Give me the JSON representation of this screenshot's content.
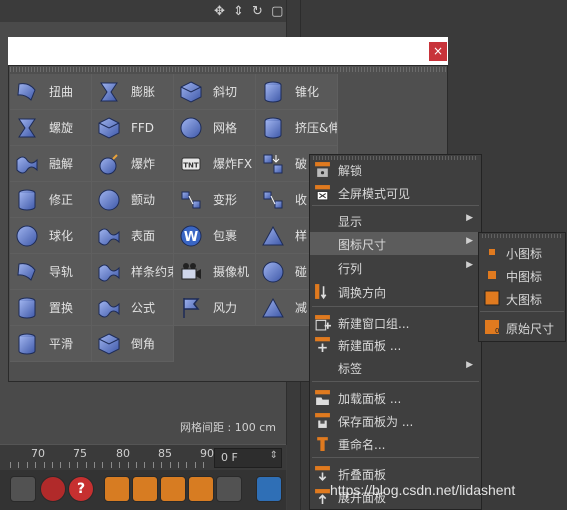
{
  "palette": {
    "items": [
      {
        "label": "扭曲",
        "icon": "bend-icon"
      },
      {
        "label": "膨胀",
        "icon": "bulge-icon"
      },
      {
        "label": "斜切",
        "icon": "shear-icon"
      },
      {
        "label": "锥化",
        "icon": "taper-icon"
      },
      {
        "label": "螺旋",
        "icon": "twist-icon"
      },
      {
        "label": "FFD",
        "icon": "ffd-icon"
      },
      {
        "label": "网格",
        "icon": "mesh-icon"
      },
      {
        "label": "挤压&伸展",
        "icon": "squash-stretch-icon"
      },
      {
        "label": "融解",
        "icon": "melt-icon"
      },
      {
        "label": "爆炸",
        "icon": "explosion-icon"
      },
      {
        "label": "爆炸FX",
        "icon": "explosion-fx-icon"
      },
      {
        "label": "破",
        "icon": "shatter-icon"
      },
      {
        "label": "修正",
        "icon": "correction-icon"
      },
      {
        "label": "颤动",
        "icon": "jiggle-icon"
      },
      {
        "label": "变形",
        "icon": "morph-icon"
      },
      {
        "label": "收",
        "icon": "shrink-wrap-icon"
      },
      {
        "label": "球化",
        "icon": "spherify-icon"
      },
      {
        "label": "表面",
        "icon": "surface-icon"
      },
      {
        "label": "包裹",
        "icon": "wrap-icon"
      },
      {
        "label": "样",
        "icon": "spline-deformer-icon"
      },
      {
        "label": "导轨",
        "icon": "rail-icon"
      },
      {
        "label": "样条约束",
        "icon": "spline-wrap-icon"
      },
      {
        "label": "摄像机",
        "icon": "camera-icon"
      },
      {
        "label": "碰",
        "icon": "collision-icon"
      },
      {
        "label": "置换",
        "icon": "displacer-icon"
      },
      {
        "label": "公式",
        "icon": "formula-icon"
      },
      {
        "label": "风力",
        "icon": "wind-icon"
      },
      {
        "label": "减",
        "icon": "polygon-reduction-icon"
      },
      {
        "label": "平滑",
        "icon": "smoothing-icon"
      },
      {
        "label": "倒角",
        "icon": "bevel-icon"
      }
    ],
    "status": "网格间距 : 100 cm",
    "close_glyph": "×"
  },
  "menu": {
    "items": [
      {
        "label": "解锁",
        "icon": "unlock-icon",
        "submenu": false
      },
      {
        "label": "全屏模式可见",
        "icon": "fullscreen-icon",
        "submenu": false
      },
      {
        "label": "显示",
        "icon": "",
        "submenu": true
      },
      {
        "label": "图标尺寸",
        "icon": "",
        "submenu": true,
        "active": true
      },
      {
        "label": "行列",
        "icon": "",
        "submenu": true
      },
      {
        "label": "调换方向",
        "icon": "swap-direction-icon",
        "submenu": false
      },
      {
        "label": "新建窗口组...",
        "icon": "new-window-group-icon",
        "submenu": false
      },
      {
        "label": "新建面板 ...",
        "icon": "new-panel-icon",
        "submenu": false
      },
      {
        "label": "标签",
        "icon": "",
        "submenu": true
      },
      {
        "label": "加载面板 ...",
        "icon": "load-panel-icon",
        "submenu": false
      },
      {
        "label": "保存面板为 ...",
        "icon": "save-panel-icon",
        "submenu": false
      },
      {
        "label": "重命名...",
        "icon": "rename-icon",
        "submenu": false
      },
      {
        "label": "折叠面板",
        "icon": "fold-panel-icon",
        "submenu": false
      },
      {
        "label": "展开面板",
        "icon": "unfold-panel-icon",
        "submenu": false
      }
    ],
    "arrow_glyph": "▶"
  },
  "icon_size_submenu": {
    "items": [
      {
        "label": "小图标",
        "icon": "small-icon-size-icon"
      },
      {
        "label": "中图标",
        "icon": "medium-icon-size-icon"
      },
      {
        "label": "大图标",
        "icon": "large-icon-size-icon"
      },
      {
        "label": "原始尺寸",
        "icon": "original-size-icon"
      }
    ]
  },
  "timeline": {
    "ticks": [
      "70",
      "75",
      "80",
      "85",
      "90"
    ],
    "frame_value": "0 F"
  },
  "watermark": "https://blog.csdn.net/lidashent",
  "colors": {
    "accent_orange": "#e07a1f",
    "close_red": "#c8333a",
    "icon_blue": "#5a78c8"
  }
}
